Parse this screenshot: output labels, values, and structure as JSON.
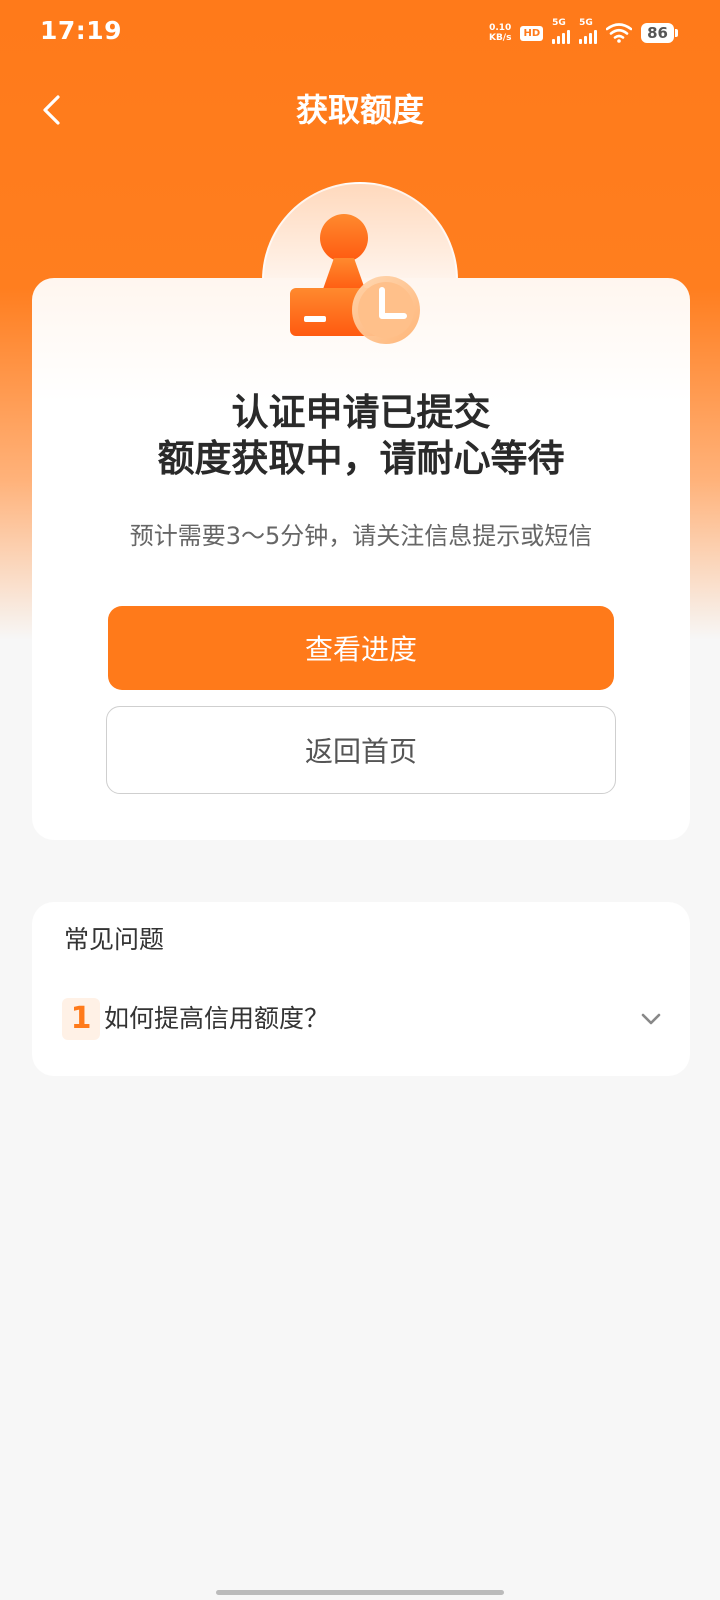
{
  "status_bar": {
    "time": "17:19",
    "net_speed_value": "0.10",
    "net_speed_unit": "KB/s",
    "hd_label": "HD",
    "signal1_label": "5G",
    "signal2_label": "5G",
    "battery": "86"
  },
  "header": {
    "title": "获取额度",
    "back_icon": "chevron-left-icon"
  },
  "main_card": {
    "icon": "stamp-clock-icon",
    "title_line1": "认证申请已提交",
    "title_line2": "额度获取中，请耐心等待",
    "subtitle": "预计需要3～5分钟，请关注信息提示或短信",
    "primary_button": "查看进度",
    "secondary_button": "返回首页"
  },
  "faq": {
    "title": "常见问题",
    "items": [
      {
        "number": "1",
        "question": "如何提高信用额度？",
        "icon": "chevron-down-icon"
      }
    ]
  },
  "colors": {
    "accent": "#ff7a1a",
    "background": "#f7f7f7",
    "card": "#ffffff"
  }
}
